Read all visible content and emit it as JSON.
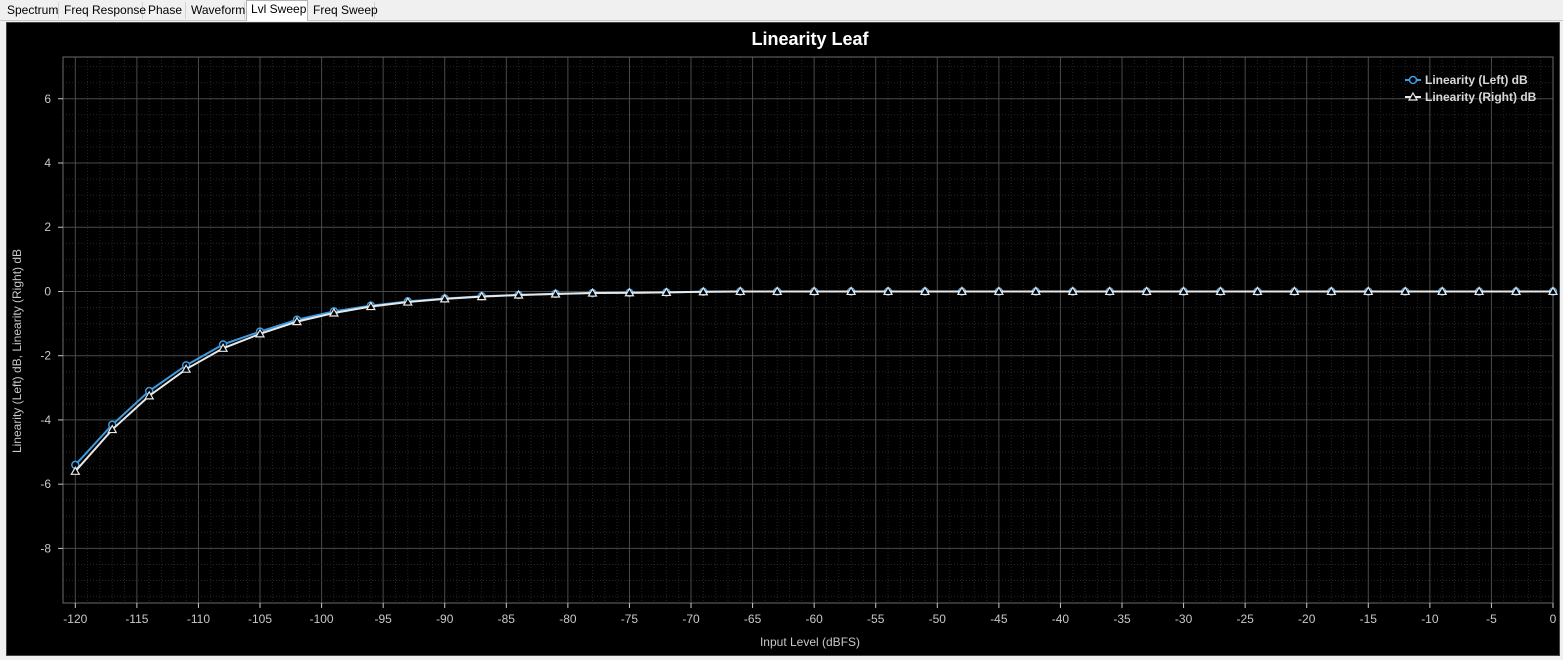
{
  "tabs": [
    {
      "label": "Spectrum",
      "active": false
    },
    {
      "label": "Freq Response",
      "active": false
    },
    {
      "label": "Phase",
      "active": false
    },
    {
      "label": "Waveform",
      "active": false
    },
    {
      "label": "Lvl Sweep",
      "active": true
    },
    {
      "label": "Freq Sweep",
      "active": false
    }
  ],
  "colors": {
    "background": "#000000",
    "grid_major": "#4a4a4a",
    "grid_minor": "#262626",
    "axis_text": "#c8c8c8",
    "title": "#ffffff",
    "series_left": "#3c9be0",
    "series_right": "#e8e8e8"
  },
  "chart_data": {
    "type": "line",
    "title": "Linearity Leaf",
    "xlabel": "Input Level (dBFS)",
    "ylabel": "Linearity (Left) dB, Linearity (Right) dB",
    "xlim": [
      -121,
      0
    ],
    "ylim": [
      -9.7,
      7.3
    ],
    "xticks": [
      -120,
      -115,
      -110,
      -105,
      -100,
      -95,
      -90,
      -85,
      -80,
      -75,
      -70,
      -65,
      -60,
      -55,
      -50,
      -45,
      -40,
      -35,
      -30,
      -25,
      -20,
      -15,
      -10,
      -5,
      0
    ],
    "yticks": [
      6,
      4,
      2,
      0,
      -2,
      -4,
      -6,
      -8
    ],
    "grid": true,
    "legend_position": "top-right",
    "x": [
      -120,
      -117,
      -114,
      -111,
      -108,
      -105,
      -102,
      -99,
      -96,
      -93,
      -90,
      -87,
      -84,
      -81,
      -78,
      -75,
      -72,
      -69,
      -66,
      -63,
      -60,
      -57,
      -54,
      -51,
      -48,
      -45,
      -42,
      -39,
      -36,
      -33,
      -30,
      -27,
      -24,
      -21,
      -18,
      -15,
      -12,
      -9,
      -6,
      -3,
      0
    ],
    "series": [
      {
        "name": "Linearity (Left) dB",
        "marker": "circle",
        "values": [
          -5.4,
          -4.15,
          -3.1,
          -2.3,
          -1.65,
          -1.25,
          -0.88,
          -0.62,
          -0.44,
          -0.31,
          -0.22,
          -0.15,
          -0.11,
          -0.07,
          -0.05,
          -0.04,
          -0.03,
          -0.01,
          0,
          0,
          0,
          0,
          0,
          0,
          0,
          0,
          0,
          0,
          0,
          0,
          0,
          0,
          0,
          0,
          0,
          0,
          0,
          0,
          0,
          0,
          0
        ]
      },
      {
        "name": "Linearity (Right) dB",
        "marker": "triangle",
        "values": [
          -5.6,
          -4.3,
          -3.25,
          -2.42,
          -1.77,
          -1.32,
          -0.94,
          -0.67,
          -0.47,
          -0.33,
          -0.23,
          -0.16,
          -0.11,
          -0.08,
          -0.05,
          -0.04,
          -0.03,
          -0.01,
          0,
          0,
          0,
          0,
          0,
          0,
          0,
          0,
          0,
          0,
          0,
          0,
          0,
          0,
          0,
          0,
          0,
          0,
          0,
          0,
          0,
          0,
          0
        ]
      }
    ]
  }
}
